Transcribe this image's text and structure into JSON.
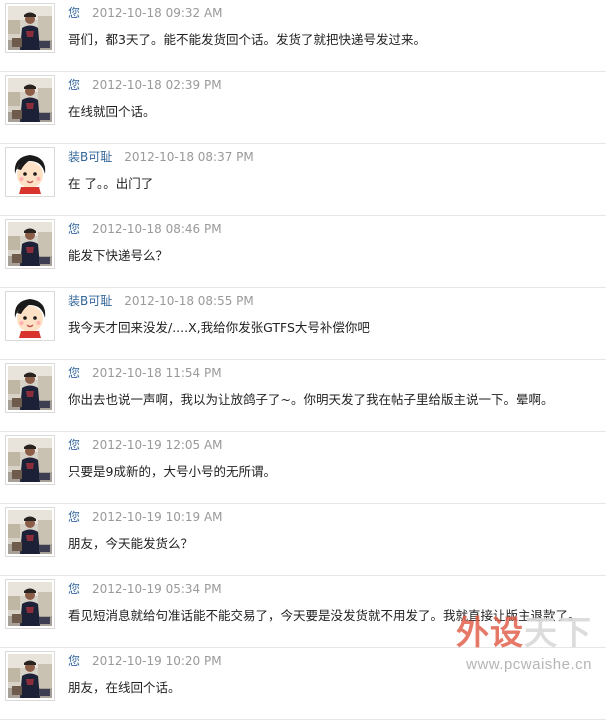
{
  "messages": [
    {
      "author": "您",
      "time": "2012-10-18 09:32 AM",
      "text": "哥们，都3天了。能不能发货回个话。发货了就把快递号发过来。",
      "avatar": "photo-avatar-icon"
    },
    {
      "author": "您",
      "time": "2012-10-18 02:39 PM",
      "text": "在线就回个话。",
      "avatar": "photo-avatar-icon"
    },
    {
      "author": "装B可耻",
      "time": "2012-10-18 08:37 PM",
      "text": "在 了。。出门了",
      "avatar": "cartoon-avatar-icon"
    },
    {
      "author": "您",
      "time": "2012-10-18 08:46 PM",
      "text": "能发下快递号么？",
      "avatar": "photo-avatar-icon"
    },
    {
      "author": "装B可耻",
      "time": "2012-10-18 08:55 PM",
      "text": "我今天才回来没发/....X,我给你发张GTFS大号补偿你吧",
      "avatar": "cartoon-avatar-icon"
    },
    {
      "author": "您",
      "time": "2012-10-18 11:54 PM",
      "text": "你出去也说一声啊，我以为让放鸽子了~。你明天发了我在帖子里给版主说一下。晕啊。",
      "avatar": "photo-avatar-icon"
    },
    {
      "author": "您",
      "time": "2012-10-19 12:05 AM",
      "text": "只要是9成新的，大号小号的无所谓。",
      "avatar": "photo-avatar-icon"
    },
    {
      "author": "您",
      "time": "2012-10-19 10:19 AM",
      "text": "朋友，今天能发货么？",
      "avatar": "photo-avatar-icon"
    },
    {
      "author": "您",
      "time": "2012-10-19 05:34 PM",
      "text": "看见短消息就给句准话能不能交易了，今天要是没发货就不用发了。我就直接让版主退款了。",
      "avatar": "photo-avatar-icon"
    },
    {
      "author": "您",
      "time": "2012-10-19 10:20 PM",
      "text": "朋友，在线回个话。",
      "avatar": "photo-avatar-icon"
    }
  ],
  "watermark": {
    "logo_part1": "外设",
    "logo_part2": "天下",
    "url": "www.pcwaishe.cn"
  }
}
